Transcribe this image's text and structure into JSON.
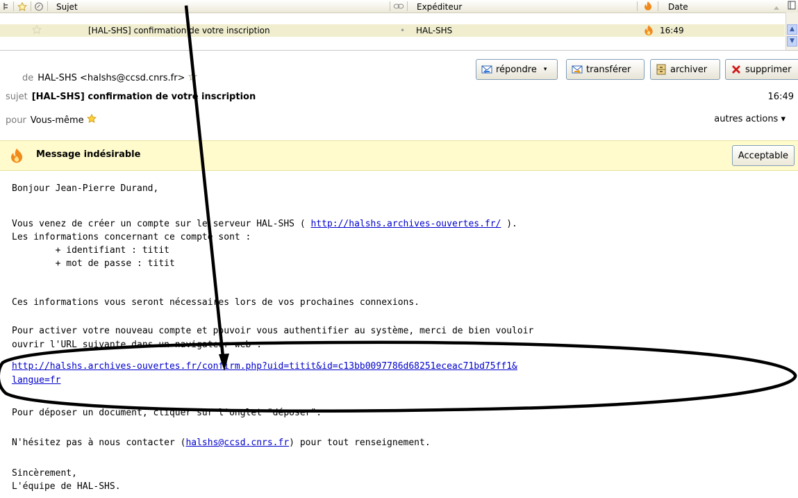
{
  "columns": {
    "subject": "Sujet",
    "sender": "Expéditeur",
    "date": "Date"
  },
  "message_row": {
    "subject": "[HAL-SHS] confirmation de votre inscription",
    "sender": "HAL-SHS",
    "time": "16:49"
  },
  "header": {
    "from_label": "de",
    "from_value": "HAL-SHS <halshs@ccsd.cnrs.fr>",
    "subject_label": "sujet",
    "subject_value": "[HAL-SHS] confirmation de votre inscription",
    "time": "16:49",
    "to_label": "pour",
    "to_value": "Vous-même",
    "more_actions": "autres actions ▾"
  },
  "toolbar": {
    "reply": "répondre",
    "forward": "transférer",
    "archive": "archiver",
    "delete": "supprimer"
  },
  "junk_bar": {
    "title": "Message indésirable",
    "button": "Acceptable"
  },
  "body": {
    "greeting": "Bonjour Jean-Pierre Durand,",
    "p1_line1_a": "Vous venez de créer un compte sur le serveur HAL-SHS ( ",
    "p1_line1_link": "http://halshs.archives-ouvertes.fr/",
    "p1_line1_b": " ).",
    "p1_line2": "Les informations concernant ce compte sont :",
    "p1_line3": "        + identifiant : titit",
    "p1_line4": "        + mot de passe : titit",
    "p2": "Ces informations vous seront nécessaires lors de vos prochaines connexions.",
    "p3_line1": "Pour activer votre nouveau compte et pouvoir vous authentifier au système, merci de bien vouloir",
    "p3_line2": "ouvrir l'URL suivante dans un navigateur web :",
    "url_line1": "http://halshs.archives-ouvertes.fr/confirm.php?uid=titit&id=c13bb0097786d68251eceac71bd75ff1&",
    "url_line2": "langue=fr",
    "p4": "Pour déposer un document, cliquer sur l'onglet \"déposer\".",
    "p5_a": "N'hésitez pas à nous contacter (",
    "p5_link": "halshs@ccsd.cnrs.fr",
    "p5_b": ") pour tout renseignement.",
    "closing": "Sincèrement,",
    "signature": "L'équipe de HAL-SHS."
  },
  "colors": {
    "link": "#0000cc",
    "junk_bg": "#fffbcd",
    "annotation": "#000000"
  }
}
